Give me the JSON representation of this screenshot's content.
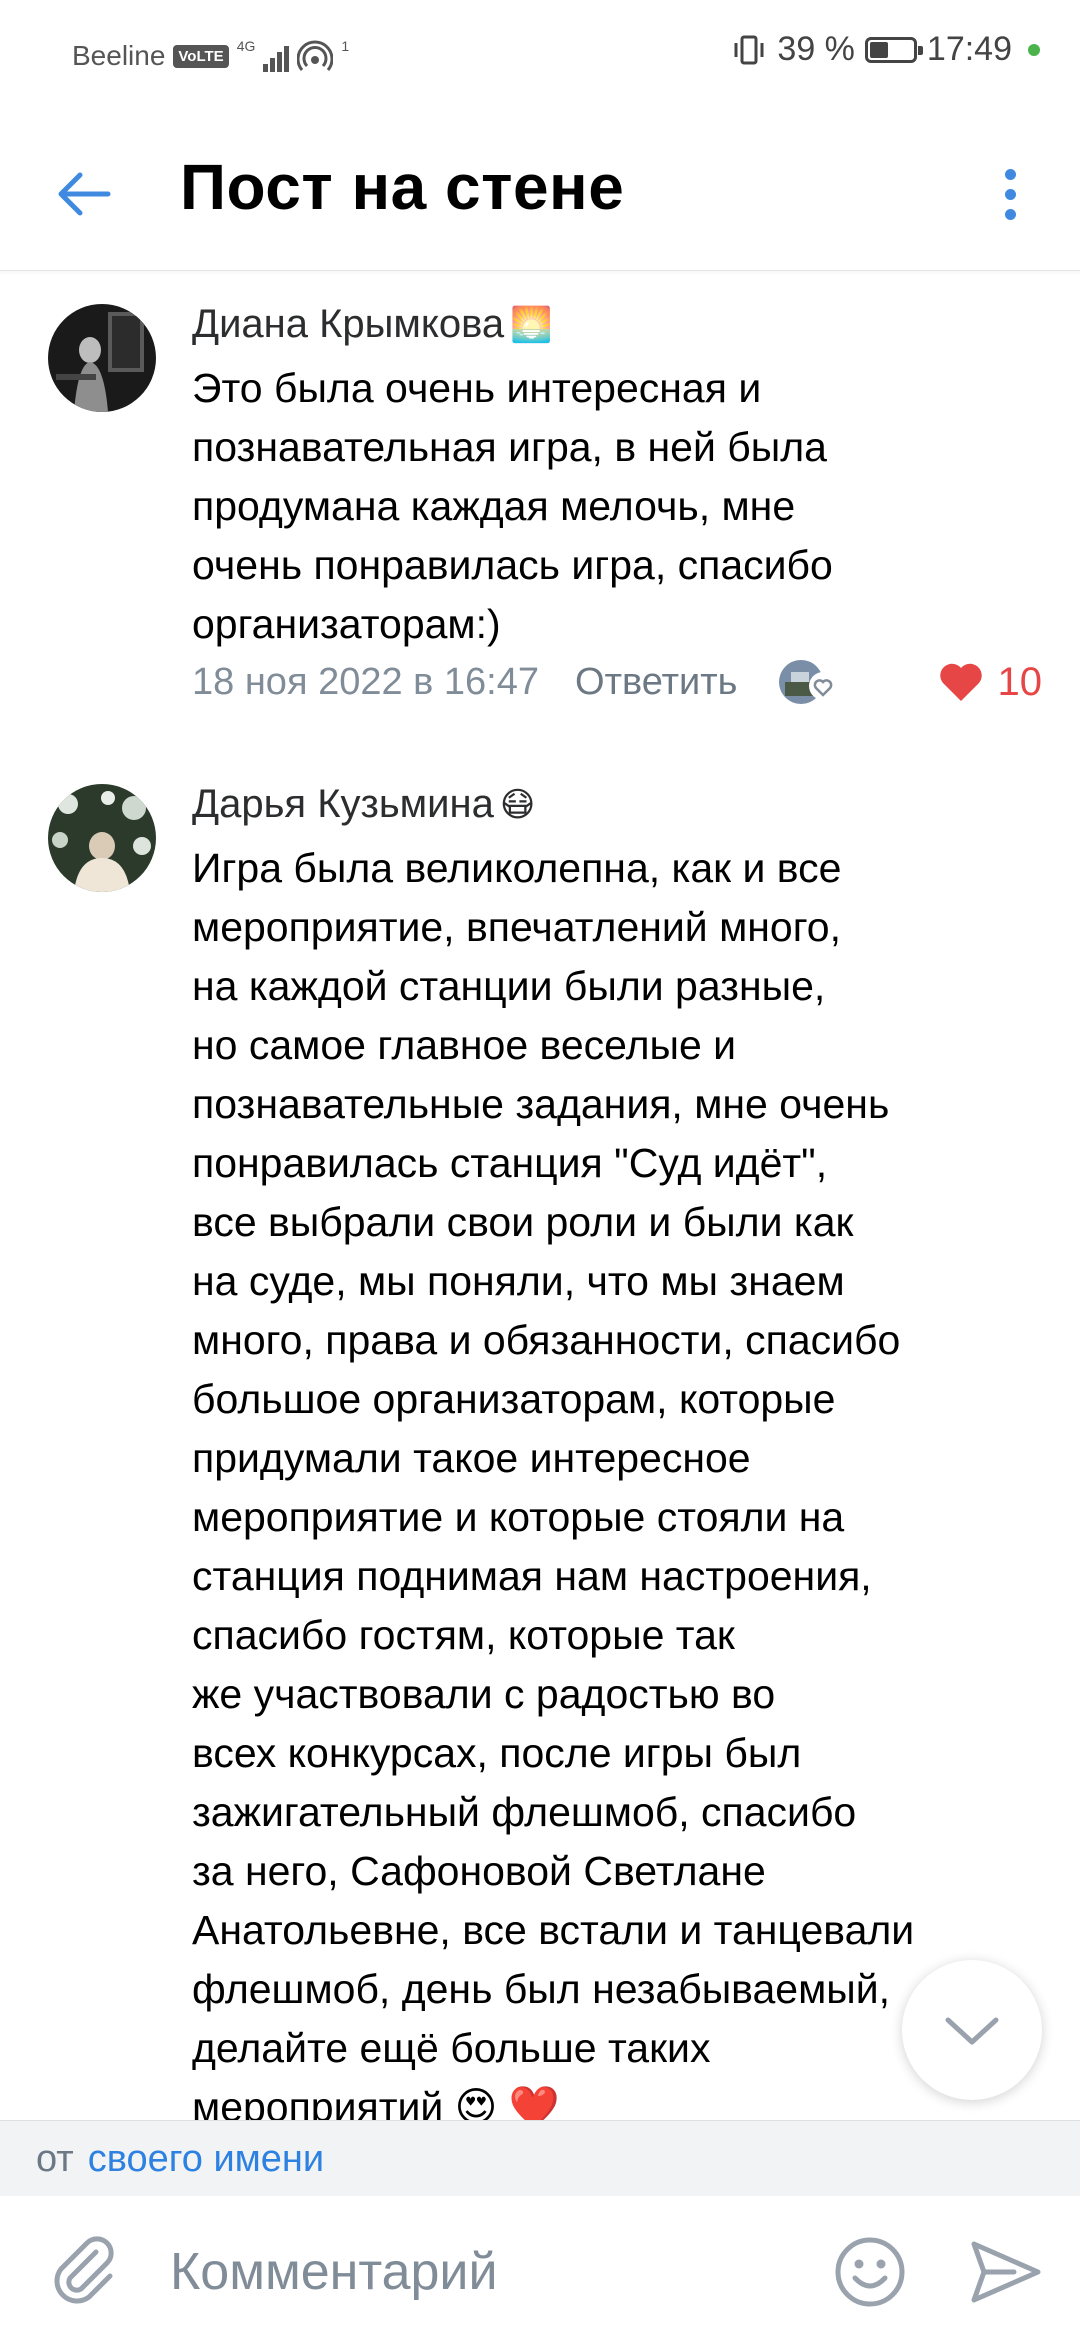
{
  "status_bar": {
    "carrier": "Beeline",
    "volte": "VoLTE",
    "network": "4G",
    "hotspot_count": "1",
    "battery_pct_label": "39 %",
    "battery_level": 0.39,
    "time": "17:49"
  },
  "header": {
    "title": "Пост на стене"
  },
  "comments": [
    {
      "author": "Диана Крымкова",
      "author_emoji": "🌅",
      "text": "Это была очень интересная и\nпознавательная игра, в ней была\nпродумана каждая мелочь, мне\nочень понравилась игра, спасибо\nорганизаторам:)",
      "date": "18 ноя 2022 в 16:47",
      "reply_label": "Ответить",
      "likes": "10"
    },
    {
      "author": "Дарья Кузьмина",
      "author_emoji": "😷",
      "text": "Игра была великолепна, как и все\nмероприятие, впечатлений много,\nна каждой станции были разные,\nно самое главное веселые и\nпознавательные задания, мне очень\nпонравилась станция \"Суд идёт\",\nвсе выбрали свои роли и были как\nна суде, мы поняли, что мы знаем\nмного, права и обязанности, спасибо\nбольшое организаторам, которые\nпридумали такое интересное\nмероприятие и которые стояли на\nстанция поднимая нам настроения,\nспасибо гостям, которые так\nже участвовали с радостью во\nвсех конкурсах, после игры был\nзажигательный флешмоб, спасибо\nза него, Сафоновой Светлане\nАнатольевне, все встали и танцевали\nфлешмоб, день был незабываемый,\nделайте ещё больше таких\nмероприятий 😍 ❤️"
    }
  ],
  "from_bar": {
    "prefix": "от",
    "name": "своего имени"
  },
  "input": {
    "placeholder": "Комментарий"
  },
  "colors": {
    "accent": "#3f8ae0",
    "like": "#e64646",
    "meta": "#818c99"
  }
}
